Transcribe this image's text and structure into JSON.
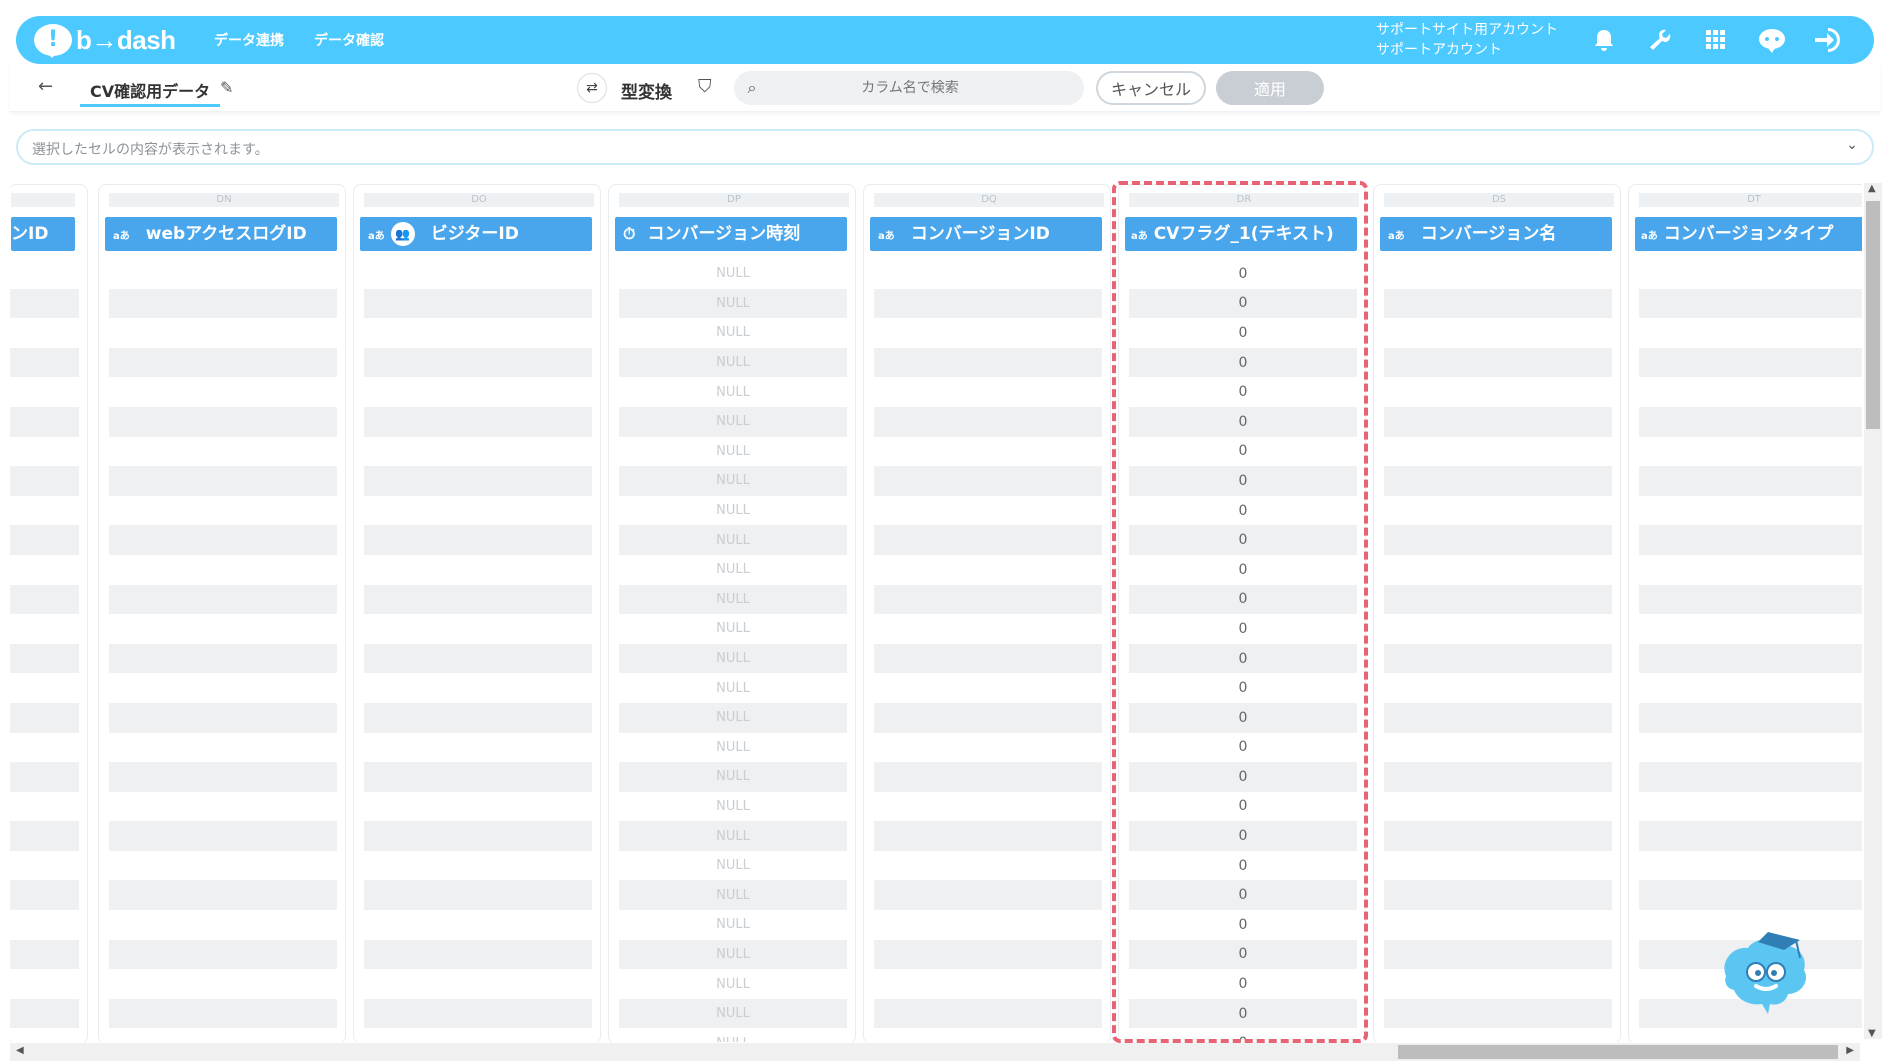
{
  "header": {
    "logo_mark": "!",
    "logo_text": "b→dash",
    "nav": [
      "データ連携",
      "データ確認"
    ],
    "account_line1": "サポートサイト用アカウント",
    "account_line2": "サポートアカウント",
    "icons": [
      "bell-icon",
      "wrench-icon",
      "apps-grid-icon",
      "chat-bot-icon",
      "logout-icon"
    ]
  },
  "toolbar": {
    "back": "←",
    "dataset_name": "CV確認用データ",
    "edit": "✎",
    "convert_label": "型変換",
    "search_placeholder": "カラム名で検索",
    "cancel_label": "キャンセル",
    "apply_label": "適用"
  },
  "cellbar": {
    "placeholder": "選択したセルの内容が表示されます。",
    "chevron": "⌄"
  },
  "columns": [
    {
      "letter": "",
      "name": "ンID",
      "type": ""
    },
    {
      "letter": "DN",
      "name": "webアクセスログID",
      "type": "aあ"
    },
    {
      "letter": "DO",
      "name": "ビジターID",
      "type": "aあ"
    },
    {
      "letter": "DP",
      "name": "コンバージョン時刻",
      "type": "⏱"
    },
    {
      "letter": "DQ",
      "name": "コンバージョンID",
      "type": "aあ"
    },
    {
      "letter": "DR",
      "name": "CVフラグ_1(テキスト)",
      "type": "aあ"
    },
    {
      "letter": "DS",
      "name": "コンバージョン名",
      "type": "aあ"
    },
    {
      "letter": "DT",
      "name": "コンバージョンタイプ",
      "type": "aあ"
    }
  ],
  "cell_values": {
    "null_text": "NULL",
    "zero_text": "0"
  },
  "colors": {
    "brand": "#4ccaff",
    "header_column": "#4aa6ec",
    "highlight": "#e86373"
  }
}
